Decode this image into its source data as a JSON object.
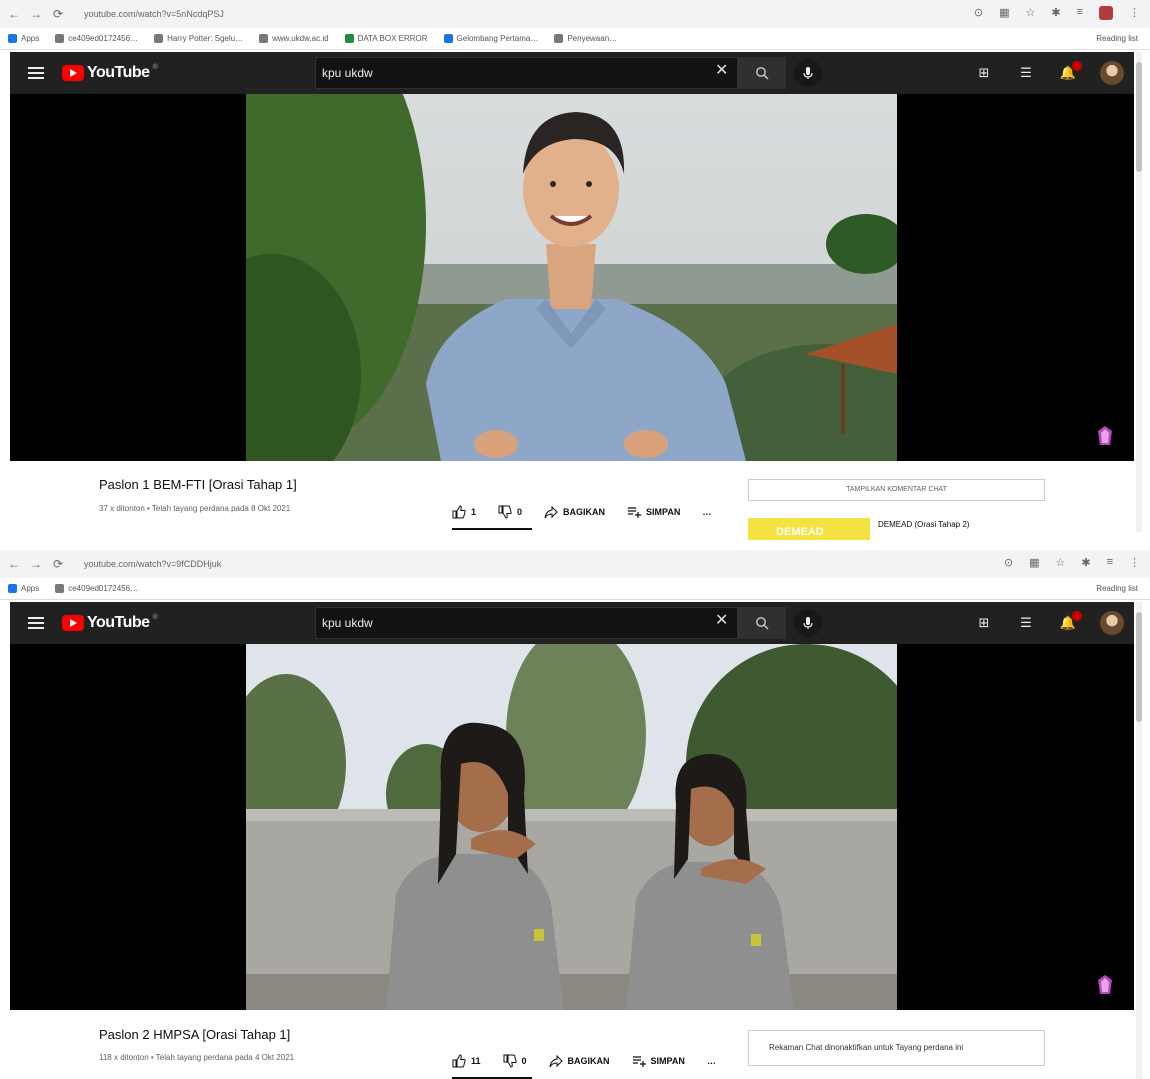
{
  "browser": {
    "bookmarks": [
      "Apps",
      "ce409ed0172456…",
      "Harry Potter: Sgelu…",
      "www.ukdw.ac.id",
      "DATA BOX ERROR",
      "Gelombang Pertama…",
      "Penyewaan…"
    ],
    "reading_list": "Reading list"
  },
  "youtube": {
    "logo": "YouTube",
    "search_value": "kpu ukdw",
    "clear": "✕"
  },
  "screens": [
    {
      "url": "youtube.com/watch?v=5nNcdqPSJ",
      "title": "Paslon 1 BEM-FTI [Orasi Tahap 1]",
      "meta": "37 x ditonton • Telah tayang perdana pada 8 Okt 2021",
      "likes": "1",
      "dislikes": "0",
      "share": "BAGIKAN",
      "save": "SIMPAN",
      "more": "…",
      "chat": "TAMPILKAN KOMENTAR CHAT",
      "promo_title": "DEMEAD",
      "promo_label": "DEMEAD (Orasi Tahap 2)"
    },
    {
      "url": "youtube.com/watch?v=9fCDDHjuk",
      "title": "Paslon 2 HMPSA [Orasi Tahap 1]",
      "meta": "118 x ditonton • Telah tayang perdana pada 4 Okt 2021",
      "likes": "11",
      "dislikes": "0",
      "share": "BAGIKAN",
      "save": "SIMPAN",
      "more": "…",
      "chat": "Rekaman Chat dinonaktifkan untuk Tayang perdana ini"
    }
  ],
  "colors": {
    "yt_red": "#ff0000",
    "header_bg": "#212121",
    "promo_yellow": "#f2e341"
  }
}
